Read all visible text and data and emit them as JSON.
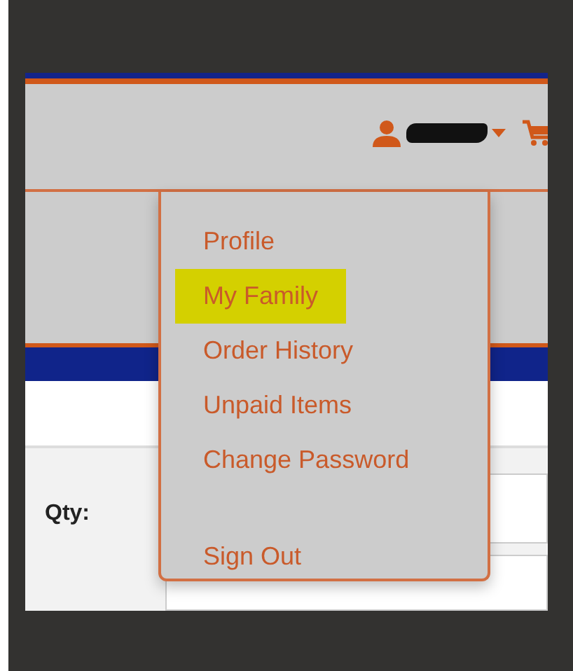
{
  "header": {
    "user_menu": {
      "expanded": true
    }
  },
  "dropdown": {
    "items": [
      {
        "label": "Profile",
        "highlighted": false
      },
      {
        "label": "My Family",
        "highlighted": true
      },
      {
        "label": "Order History",
        "highlighted": false
      },
      {
        "label": "Unpaid Items",
        "highlighted": false
      },
      {
        "label": "Change Password",
        "highlighted": false
      },
      {
        "kind": "divider"
      },
      {
        "label": "Sign Out",
        "highlighted": false
      }
    ]
  },
  "form": {
    "qty_label": "Qty:"
  }
}
